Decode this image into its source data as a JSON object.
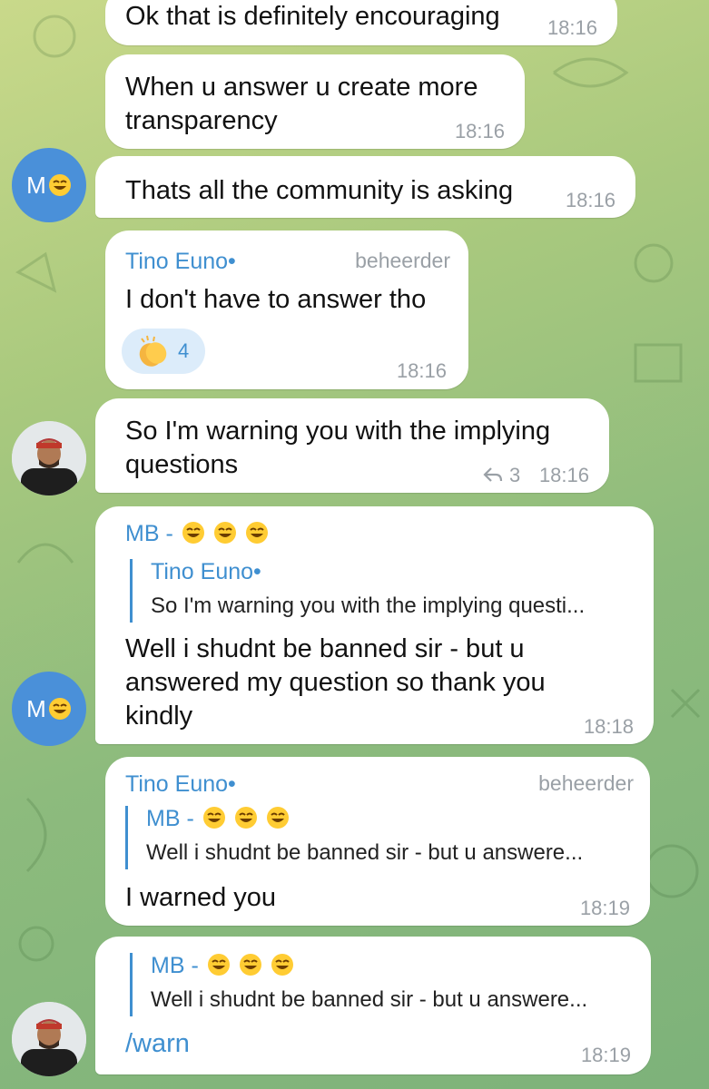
{
  "colors": {
    "accent": "#3f8fd0",
    "bubble": "#ffffff",
    "avatar_mb": "#4a90d9",
    "reaction_bg": "#dcecfa"
  },
  "messages": [
    {
      "text": "Ok that is definitely encouraging",
      "time": "18:16"
    },
    {
      "text_line1": "When u answer u create more",
      "text_line2": "transparency",
      "time": "18:16"
    },
    {
      "text": "Thats all the community is asking",
      "time": "18:16",
      "avatar_initial": "M"
    },
    {
      "sender": "Tino Euno•",
      "role": "beheerder",
      "text": "I don't have to answer tho",
      "reaction_count": "4",
      "time": "18:16"
    },
    {
      "text_line1": "So I'm warning you with the implying",
      "text_line2": "questions",
      "reply_count": "3",
      "time": "18:16"
    },
    {
      "sender": "MB -",
      "quote_name": "Tino Euno•",
      "quote_text": "So I'm warning you with the implying questi...",
      "text_line1": "Well i shudnt be banned sir - but u",
      "text_line2": "answered my question so thank you",
      "text_line3": "kindly",
      "time": "18:18",
      "avatar_initial": "M"
    },
    {
      "sender": "Tino Euno•",
      "role": "beheerder",
      "quote_name": "MB -",
      "quote_text": "Well i shudnt be banned sir - but u answere...",
      "text": "I warned you",
      "time": "18:19"
    },
    {
      "quote_name": "MB -",
      "quote_text": "Well i shudnt be banned sir - but u answere...",
      "text": "/warn",
      "time": "18:19"
    }
  ],
  "icons": {
    "laugh": "face-with-tears-of-joy",
    "clap": "clapping-hands",
    "reply": "reply-arrow"
  }
}
